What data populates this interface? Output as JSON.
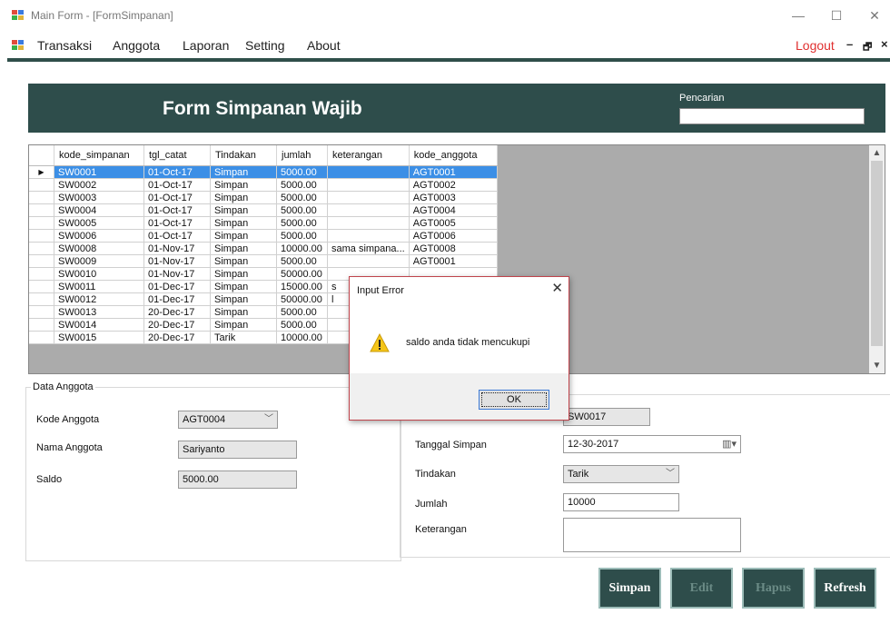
{
  "window": {
    "title": "Main Form - [FormSimpanan]",
    "minimize": "—",
    "maximize": "☐",
    "close": "✕"
  },
  "menu": {
    "items": [
      "Transaksi",
      "Anggota",
      "Laporan",
      "Setting",
      "About"
    ],
    "logout": "Logout",
    "mdi_minimize": "–",
    "mdi_restore": "🗗",
    "mdi_close": "×"
  },
  "form": {
    "title": "Form Simpanan Wajib",
    "search_label": "Pencarian",
    "search_value": ""
  },
  "grid": {
    "columns": [
      "kode_simpanan",
      "tgl_catat",
      "Tindakan",
      "jumlah",
      "keterangan",
      "kode_anggota"
    ],
    "current_row_marker": "▶",
    "scroll_up": "▲",
    "scroll_down": "▼",
    "rows": [
      [
        "SW0001",
        "01-Oct-17",
        "Simpan",
        "5000.00",
        "",
        "AGT0001"
      ],
      [
        "SW0002",
        "01-Oct-17",
        "Simpan",
        "5000.00",
        "",
        "AGT0002"
      ],
      [
        "SW0003",
        "01-Oct-17",
        "Simpan",
        "5000.00",
        "",
        "AGT0003"
      ],
      [
        "SW0004",
        "01-Oct-17",
        "Simpan",
        "5000.00",
        "",
        "AGT0004"
      ],
      [
        "SW0005",
        "01-Oct-17",
        "Simpan",
        "5000.00",
        "",
        "AGT0005"
      ],
      [
        "SW0006",
        "01-Oct-17",
        "Simpan",
        "5000.00",
        "",
        "AGT0006"
      ],
      [
        "SW0008",
        "01-Nov-17",
        "Simpan",
        "10000.00",
        "sama simpana...",
        "AGT0008"
      ],
      [
        "SW0009",
        "01-Nov-17",
        "Simpan",
        "5000.00",
        "",
        "AGT0001"
      ],
      [
        "SW0010",
        "01-Nov-17",
        "Simpan",
        "50000.00",
        "",
        ""
      ],
      [
        "SW0011",
        "01-Dec-17",
        "Simpan",
        "15000.00",
        "s",
        ""
      ],
      [
        "SW0012",
        "01-Dec-17",
        "Simpan",
        "50000.00",
        "l",
        ""
      ],
      [
        "SW0013",
        "20-Dec-17",
        "Simpan",
        "5000.00",
        "",
        ""
      ],
      [
        "SW0014",
        "20-Dec-17",
        "Simpan",
        "5000.00",
        "",
        ""
      ],
      [
        "SW0015",
        "20-Dec-17",
        "Tarik",
        "10000.00",
        "",
        ""
      ]
    ]
  },
  "anggota": {
    "legend": "Data Anggota",
    "kode_label": "Kode Anggota",
    "kode_value": "AGT0004",
    "nama_label": "Nama Anggota",
    "nama_value": "Sariyanto",
    "saldo_label": "Saldo",
    "saldo_value": "5000.00"
  },
  "simpanan": {
    "kode_value": "SW0017",
    "tanggal_label": "Tanggal Simpan",
    "tanggal_value": "12-30-2017",
    "tindakan_label": "Tindakan",
    "tindakan_value": "Tarik",
    "jumlah_label": "Jumlah",
    "jumlah_value": "10000",
    "keterangan_label": "Keterangan",
    "keterangan_value": ""
  },
  "buttons": {
    "simpan": "Simpan",
    "edit": "Edit",
    "hapus": "Hapus",
    "refresh": "Refresh"
  },
  "dialog": {
    "title": "Input Error",
    "message": "saldo anda tidak mencukupi",
    "ok": "OK",
    "close": "✕",
    "icon": "warning-icon"
  }
}
